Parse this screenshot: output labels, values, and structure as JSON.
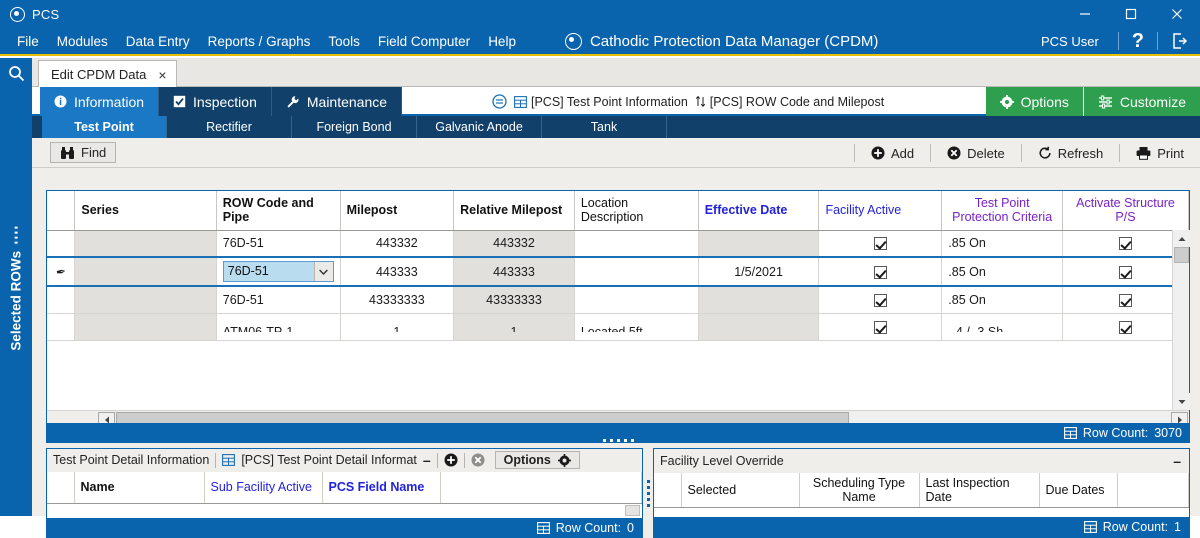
{
  "window": {
    "app_name": "PCS",
    "minimize": "minimize-icon",
    "maximize": "maximize-icon",
    "close": "close-icon"
  },
  "menu": {
    "items": [
      "File",
      "Modules",
      "Data Entry",
      "Reports / Graphs",
      "Tools",
      "Field Computer",
      "Help"
    ],
    "brand_title": "Cathodic Protection Data Manager (CPDM)",
    "user": "PCS User",
    "help_glyph": "?",
    "logout_icon": "logout-icon"
  },
  "doc_tabs": {
    "active": "Edit CPDM Data",
    "close_glyph": "×"
  },
  "left_rail": {
    "search_icon": "search-icon",
    "vertical_tab": "Selected ROWs"
  },
  "ribbon": {
    "tabs": [
      {
        "label": "Information",
        "icon": "info-icon",
        "active": true
      },
      {
        "label": "Inspection",
        "icon": "checkbox-icon",
        "active": false
      },
      {
        "label": "Maintenance",
        "icon": "wrench-icon",
        "active": false
      }
    ],
    "collapse_icon": "collapse-circle-icon",
    "chips": [
      {
        "label": "[PCS] Test Point Information",
        "icon": "grid-icon"
      },
      {
        "label": "[PCS] ROW Code and Milepost",
        "icon": "sort-icon"
      }
    ],
    "buttons": [
      {
        "label": "Options",
        "icon": "gear-icon"
      },
      {
        "label": "Customize",
        "icon": "customize-icon"
      }
    ],
    "green": "#2e9e4f"
  },
  "subtabs": [
    {
      "label": "Test Point",
      "active": true
    },
    {
      "label": "Rectifier",
      "active": false
    },
    {
      "label": "Foreign Bond",
      "active": false
    },
    {
      "label": "Galvanic Anode",
      "active": false
    },
    {
      "label": "Tank",
      "active": false
    }
  ],
  "toolbar": {
    "find": "Find",
    "find_icon": "binoculars-icon",
    "actions": [
      {
        "label": "Add",
        "icon": "plus-circle-icon"
      },
      {
        "label": "Delete",
        "icon": "x-circle-icon"
      },
      {
        "label": "Refresh",
        "icon": "refresh-icon"
      },
      {
        "label": "Print",
        "icon": "printer-icon"
      }
    ]
  },
  "grid": {
    "columns": [
      {
        "label": "",
        "style": "plain"
      },
      {
        "label": "Series",
        "style": "b"
      },
      {
        "label": "ROW Code and Pipe",
        "style": "b"
      },
      {
        "label": "Milepost",
        "style": "b"
      },
      {
        "label": "Relative Milepost",
        "style": "b"
      },
      {
        "label": "Location Description",
        "style": "plain"
      },
      {
        "label": "Effective Date",
        "style": "blueb"
      },
      {
        "label": "Facility Active",
        "style": "blue"
      },
      {
        "label": "Test Point Protection Criteria",
        "style": "purple"
      },
      {
        "label": "Activate Structure P/S",
        "style": "purple"
      }
    ],
    "rows": [
      {
        "editing": false,
        "marker": "",
        "series": "",
        "row_code": "76D-51",
        "milepost": "443332",
        "relative_milepost": "443332",
        "location_description": "",
        "effective_date": "",
        "facility_active": true,
        "criteria": ".85 On",
        "activate_structure": true
      },
      {
        "editing": true,
        "marker": "pencil-icon",
        "series": "",
        "row_code": "76D-51",
        "milepost": "443333",
        "relative_milepost": "443333",
        "location_description": "",
        "effective_date": "1/5/2021",
        "facility_active": true,
        "criteria": ".85 On",
        "activate_structure": true
      },
      {
        "editing": false,
        "marker": "",
        "series": "",
        "row_code": "76D-51",
        "milepost": "43333333",
        "relative_milepost": "43333333",
        "location_description": "",
        "effective_date": "",
        "facility_active": true,
        "criteria": ".85 On",
        "activate_structure": true
      }
    ],
    "clipped_row": {
      "row_code": "ATM06-TP-1",
      "milepost": "1",
      "relative_milepost": "1",
      "location_description": "Located 5ft",
      "criteria": "-.4 /-.3 Sh"
    },
    "row_count_label": "Row Count:",
    "row_count_value": "3070",
    "row_count_icon": "grid-icon"
  },
  "bottom_left": {
    "title": "Test Point Detail Information",
    "dataset": "[PCS] Test Point Detail Informat",
    "dataset_icon": "grid-icon",
    "minimize_glyph": "–",
    "add_icon": "plus-circle-icon",
    "delete_icon": "x-circle-icon",
    "options_label": "Options",
    "options_icon": "gear-icon",
    "columns": [
      {
        "label": "",
        "style": "n"
      },
      {
        "label": "Name",
        "style": "b"
      },
      {
        "label": "Sub Facility Active",
        "style": "blue"
      },
      {
        "label": "PCS Field Name",
        "style": "blueb"
      },
      {
        "label": "",
        "style": "n"
      }
    ],
    "row_count_label": "Row Count:",
    "row_count_value": "0",
    "row_count_icon": "grid-icon"
  },
  "bottom_right": {
    "title": "Facility Level Override",
    "minimize_glyph": "–",
    "columns": [
      {
        "label": "",
        "style": "n"
      },
      {
        "label": "Selected",
        "style": "n"
      },
      {
        "label": "Scheduling Type Name",
        "style": "n ctr"
      },
      {
        "label": "Last Inspection Date",
        "style": "n"
      },
      {
        "label": "Due Dates",
        "style": "n"
      },
      {
        "label": "",
        "style": "n"
      }
    ],
    "row_count_label": "Row Count:",
    "row_count_value": "1",
    "row_count_icon": "grid-icon"
  }
}
